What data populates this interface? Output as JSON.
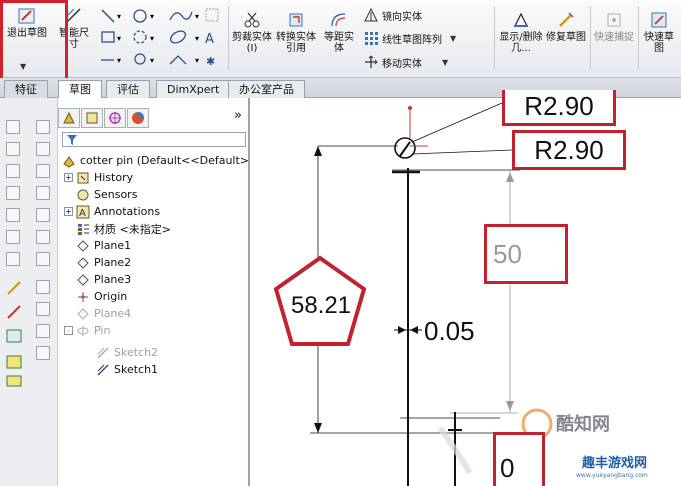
{
  "ribbon": {
    "exit_sketch": "退出草图",
    "smart_dim": "智能尺寸",
    "trim": "剪裁实体(I)",
    "convert": "转换实体引用",
    "offset": "等距实体",
    "mirror": "镜向实体",
    "linear_pattern": "线性草图阵列",
    "move": "移动实体",
    "display_delete": "显示/删除几...",
    "repair": "修复草图",
    "quick_snap": "快速捕捉",
    "rapid_sketch": "快速草图"
  },
  "tabs": [
    "特征",
    "草图",
    "评估",
    "DimXpert",
    "办公室产品"
  ],
  "feature_tree": {
    "root": "cotter pin  (Default<<Default>",
    "items": [
      {
        "label": "History",
        "expand": "+"
      },
      {
        "label": "Sensors",
        "expand": ""
      },
      {
        "label": "Annotations",
        "expand": "+"
      },
      {
        "label": "材质 <未指定>",
        "expand": ""
      },
      {
        "label": "Plane1",
        "expand": ""
      },
      {
        "label": "Plane2",
        "expand": ""
      },
      {
        "label": "Plane3",
        "expand": ""
      },
      {
        "label": "Origin",
        "expand": ""
      },
      {
        "label": "Plane4",
        "expand": ""
      },
      {
        "label": "Pin",
        "expand": "-"
      },
      {
        "label": "Sketch2",
        "expand": ""
      },
      {
        "label": "Sketch1",
        "expand": ""
      }
    ],
    "collapse_arrow": "»"
  },
  "canvas": {
    "dim_r_top": "R2.90",
    "dim_r_second": "R2.90",
    "dim_50": "50",
    "dim_58": "58.21",
    "dim_005": "0.05",
    "dim_bottom": "0"
  },
  "watermark": {
    "line1": "酷知网",
    "line2": "趣丰游戏网",
    "url": "www.yueyangbang.com"
  },
  "colors": {
    "highlight_red": "#d3212b",
    "dim_grey": "#999999"
  }
}
